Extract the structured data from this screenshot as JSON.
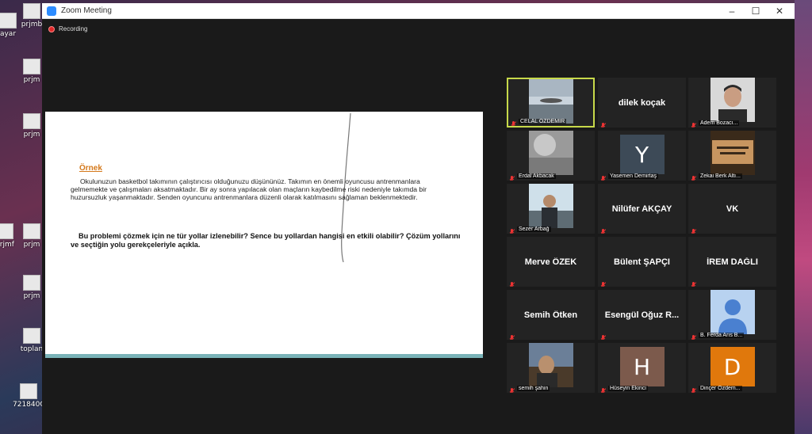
{
  "window": {
    "title": "Zoom Meeting",
    "minimize": "–",
    "maximize": "☐",
    "close": "✕"
  },
  "recording": {
    "label": "Recording"
  },
  "desktop_icons": [
    {
      "label": "ayar"
    },
    {
      "label": "prjmb"
    },
    {
      "label": "prjm"
    },
    {
      "label": "prjm"
    },
    {
      "label": "prjm"
    },
    {
      "label": "prjmf"
    },
    {
      "label": "prjm"
    },
    {
      "label": "toplan"
    },
    {
      "label": "721840C"
    }
  ],
  "slide": {
    "heading": "Örnek",
    "paragraph": "Okulunuzun basketbol takımının çalıştırıcısı olduğunuzu düşününüz. Takımın en önemli oyuncusu antrenmanlara gelmemekte ve çalışmaları aksatmaktadır. Bir ay sonra yapılacak olan maçların kaybedilme riski nedeniyle takımda bir huzursuzluk yaşanmaktadır. Senden oyuncunu antrenmanlara düzenli olarak katılmasını sağlaman beklenmektedir.",
    "question": "Bu problemi çözmek için ne tür yollar izlenebilir? Sence bu yollardan hangisi en etkili olabilir? Çözüm yollarını ve seçtiğin yolu gerekçeleriyle açıkla."
  },
  "participants": [
    {
      "name": "CELAL ÖZDEMİR",
      "type": "video",
      "active": true,
      "scene": "landscape"
    },
    {
      "name": "dilek koçak",
      "type": "name"
    },
    {
      "name": "Adem Bozacı...",
      "type": "video",
      "scene": "face"
    },
    {
      "name": "Erdal Akbacak",
      "type": "video",
      "scene": "blur"
    },
    {
      "name": "Yasemen Demirtaş",
      "type": "letter",
      "letter": "Y",
      "color": "#3d4a57"
    },
    {
      "name": "Zekai Berk Altı...",
      "type": "video",
      "scene": "card"
    },
    {
      "name": "Sezer Arbağ",
      "type": "video",
      "scene": "person"
    },
    {
      "name": "Nilüfer AKÇAY",
      "type": "name"
    },
    {
      "name": "VK",
      "type": "name"
    },
    {
      "name": "Merve ÖZEK",
      "type": "name"
    },
    {
      "name": "Bülent ŞAPÇI",
      "type": "name"
    },
    {
      "name": "İREM DAĞLI",
      "type": "name"
    },
    {
      "name": "Semih Ötken",
      "type": "name"
    },
    {
      "name": "Esengül Oğuz R...",
      "type": "name"
    },
    {
      "name": "B. Ferda Arıs B...",
      "type": "profile"
    },
    {
      "name": "semih şahin",
      "type": "video",
      "scene": "selfie"
    },
    {
      "name": "Hüseyin Ekinci",
      "type": "letter",
      "letter": "H",
      "color": "#7c5a4c"
    },
    {
      "name": "Dinçer Özdem...",
      "type": "letter",
      "letter": "D",
      "color": "#e0780c"
    }
  ]
}
